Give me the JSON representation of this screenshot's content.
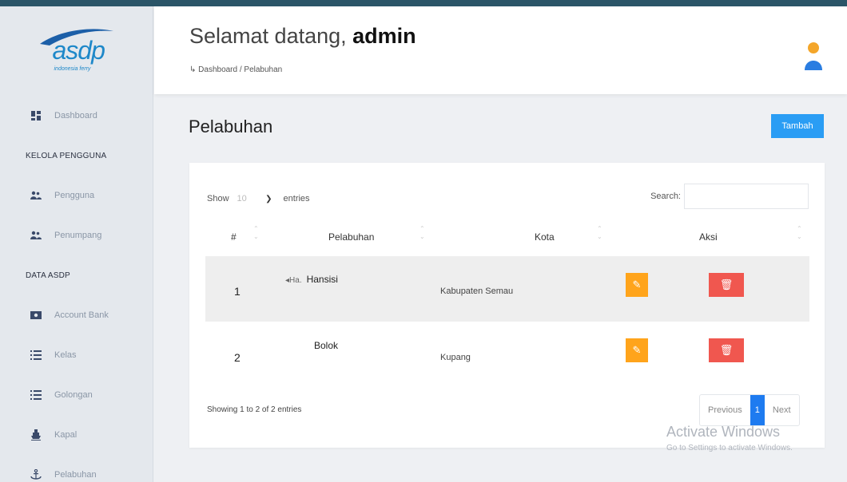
{
  "logo": {
    "brand": "asdp",
    "tagline": "indonesia ferry"
  },
  "sidebar": {
    "dashboard": "Dashboard",
    "section_kelola": "KELOLA PENGGUNA",
    "pengguna": "Pengguna",
    "penumpang": "Penumpang",
    "section_data": "DATA ASDP",
    "account_bank": "Account Bank",
    "kelas": "Kelas",
    "golongan": "Golongan",
    "kapal": "Kapal",
    "pelabuhan": "Pelabuhan"
  },
  "header": {
    "welcome_prefix": "Selamat datang,",
    "username": "admin",
    "breadcrumb": "↳ Dashboard / Pelabuhan"
  },
  "page": {
    "title": "Pelabuhan",
    "add_button": "Tambah"
  },
  "table": {
    "show_label": "Show",
    "entries_value": "10",
    "entries_label": "entries",
    "search_label": "Search:",
    "search_value": "",
    "columns": {
      "num": "#",
      "pelabuhan": "Pelabuhan",
      "kota": "Kota",
      "aksi": "Aksi"
    },
    "rows": [
      {
        "num": "1",
        "img_alt": "Ha.",
        "pelabuhan": "Hansisi",
        "kota": "Kabupaten Semau"
      },
      {
        "num": "2",
        "pelabuhan": "Bolok",
        "kota": "Kupang"
      }
    ],
    "info": "Showing 1 to 2 of 2 entries",
    "prev": "Previous",
    "current_page": "1",
    "next": "Next"
  },
  "watermark": {
    "line1": "Activate Windows",
    "line2": "Go to Settings to activate Windows."
  },
  "colors": {
    "accent": "#2a9df4",
    "edit": "#ffa41b",
    "delete": "#f0574f",
    "page_active": "#1e7bf0"
  }
}
